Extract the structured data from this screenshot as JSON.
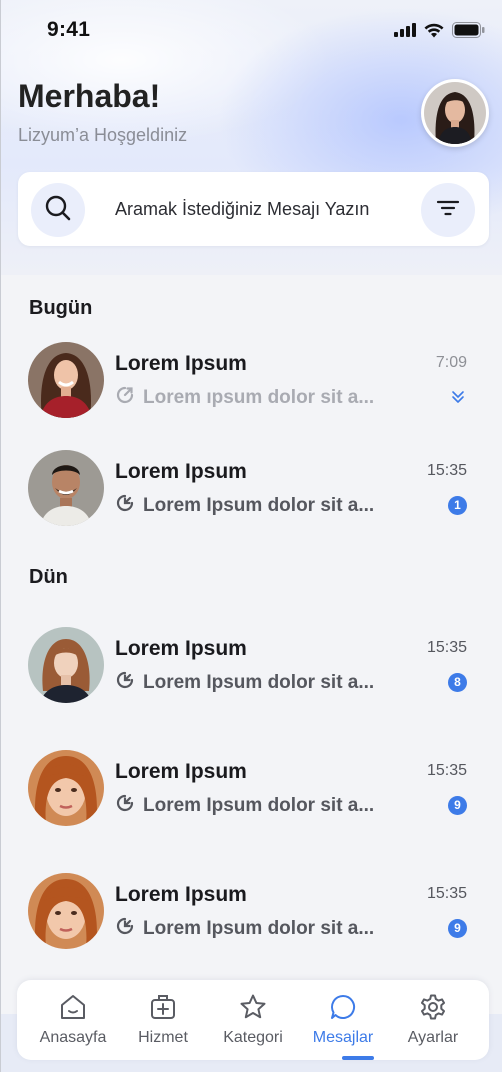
{
  "status_bar": {
    "time": "9:41"
  },
  "header": {
    "greeting": "Merhaba!",
    "subtitle": "Lizyum’a Hoşgeldiniz"
  },
  "search": {
    "placeholder": "Aramak İstediğiniz Mesajı Yazın"
  },
  "sections": [
    {
      "title": "Bugün",
      "chats": [
        {
          "name": "Lorem Ipsum",
          "preview": "Lorem ıpsum dolor sit a...",
          "time": "7:09",
          "status": "read"
        },
        {
          "name": "Lorem Ipsum",
          "preview": "Lorem Ipsum dolor sit a...",
          "time": "15:35",
          "unread": "1"
        }
      ]
    },
    {
      "title": "Dün",
      "chats": [
        {
          "name": "Lorem Ipsum",
          "preview": "Lorem Ipsum dolor sit a...",
          "time": "15:35",
          "unread": "8"
        },
        {
          "name": "Lorem Ipsum",
          "preview": "Lorem Ipsum dolor sit a...",
          "time": "15:35",
          "unread": "9"
        },
        {
          "name": "Lorem Ipsum",
          "preview": "Lorem Ipsum dolor sit a...",
          "time": "15:35",
          "unread": "9"
        }
      ]
    }
  ],
  "tabs": [
    {
      "label": "Anasayfa",
      "icon": "home-icon"
    },
    {
      "label": "Hizmet",
      "icon": "medical-bag-icon"
    },
    {
      "label": "Kategori",
      "icon": "star-icon"
    },
    {
      "label": "Mesajlar",
      "icon": "chat-bubble-icon",
      "active": true
    },
    {
      "label": "Ayarlar",
      "icon": "gear-icon"
    }
  ],
  "colors": {
    "accent": "#3d7be8",
    "background": "#f3f4f7",
    "card": "#ffffff"
  }
}
